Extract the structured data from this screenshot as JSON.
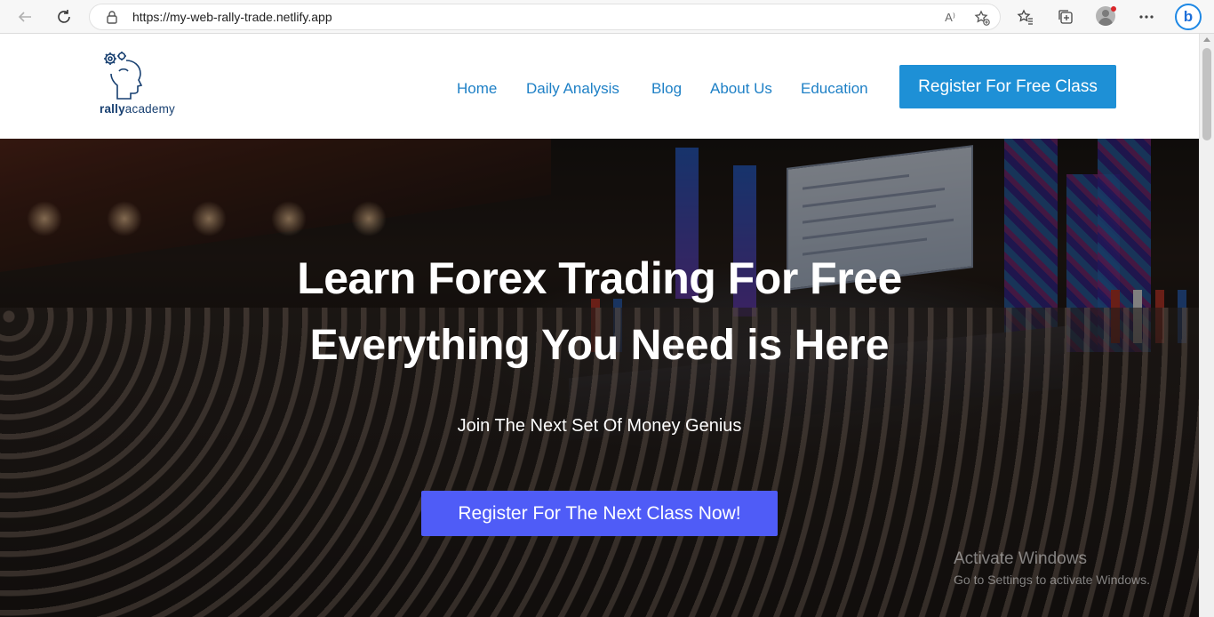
{
  "browser": {
    "url": "https://my-web-rally-trade.netlify.app",
    "read_aloud_label": "A⁾"
  },
  "header": {
    "logo_text_bold": "rally",
    "logo_text_regular": "academy",
    "nav": [
      {
        "label": "Home"
      },
      {
        "label": "Daily Analysis"
      },
      {
        "label": "Blog"
      },
      {
        "label": "About Us"
      },
      {
        "label": "Education"
      }
    ],
    "cta_label": "Register For Free Class",
    "cta_color": "#1e90d6",
    "nav_color": "#1e80c6"
  },
  "hero": {
    "title": "Learn Forex Trading For Free",
    "subtitle": "Everything You Need is Here",
    "tagline": "Join The Next Set Of Money Genius",
    "cta_label": "Register For The Next Class Now!",
    "cta_color": "#4f5cf7"
  },
  "watermark": {
    "title": "Activate Windows",
    "subtitle": "Go to Settings to activate Windows."
  }
}
